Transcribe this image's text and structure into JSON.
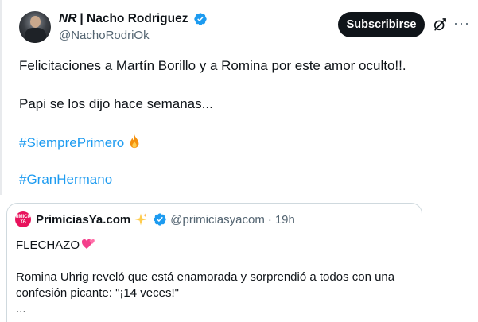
{
  "author": {
    "prefix": "NR",
    "name_rest": "| Nacho Rodriguez",
    "handle": "@NachoRodriOk",
    "verified": true
  },
  "actions": {
    "subscribe_label": "Subscribirse",
    "more_label": "···"
  },
  "tweet": {
    "line1": "Felicitaciones a Martín Borillo y a Romina por este amor oculto!!.",
    "line2": "Papi se los dijo hace semanas...",
    "hashtag1": "#SiemprePrimero",
    "hashtag2": "#GranHermano"
  },
  "quote": {
    "avatar_text": "PRIMICIAS YA",
    "name": "PrimiciasYa.com",
    "handle": "@primiciasyacom",
    "separator": "·",
    "time": "19h",
    "line1": "FLECHAZO",
    "line2": "Romina Uhrig reveló que está enamorada y sorprendió a todos con una",
    "line3": "confesión picante: \"¡14 veces!\"",
    "line4": "..."
  },
  "colors": {
    "accent": "#1d9bf0",
    "text": "#0f1419",
    "muted": "#536471",
    "button_bg": "#0f1419",
    "brand_pink": "#e8125c"
  },
  "icons": [
    "verified-badge-icon",
    "grok-icon",
    "more-icon",
    "fire-icon",
    "sparkle-icon",
    "hearts-icon"
  ]
}
